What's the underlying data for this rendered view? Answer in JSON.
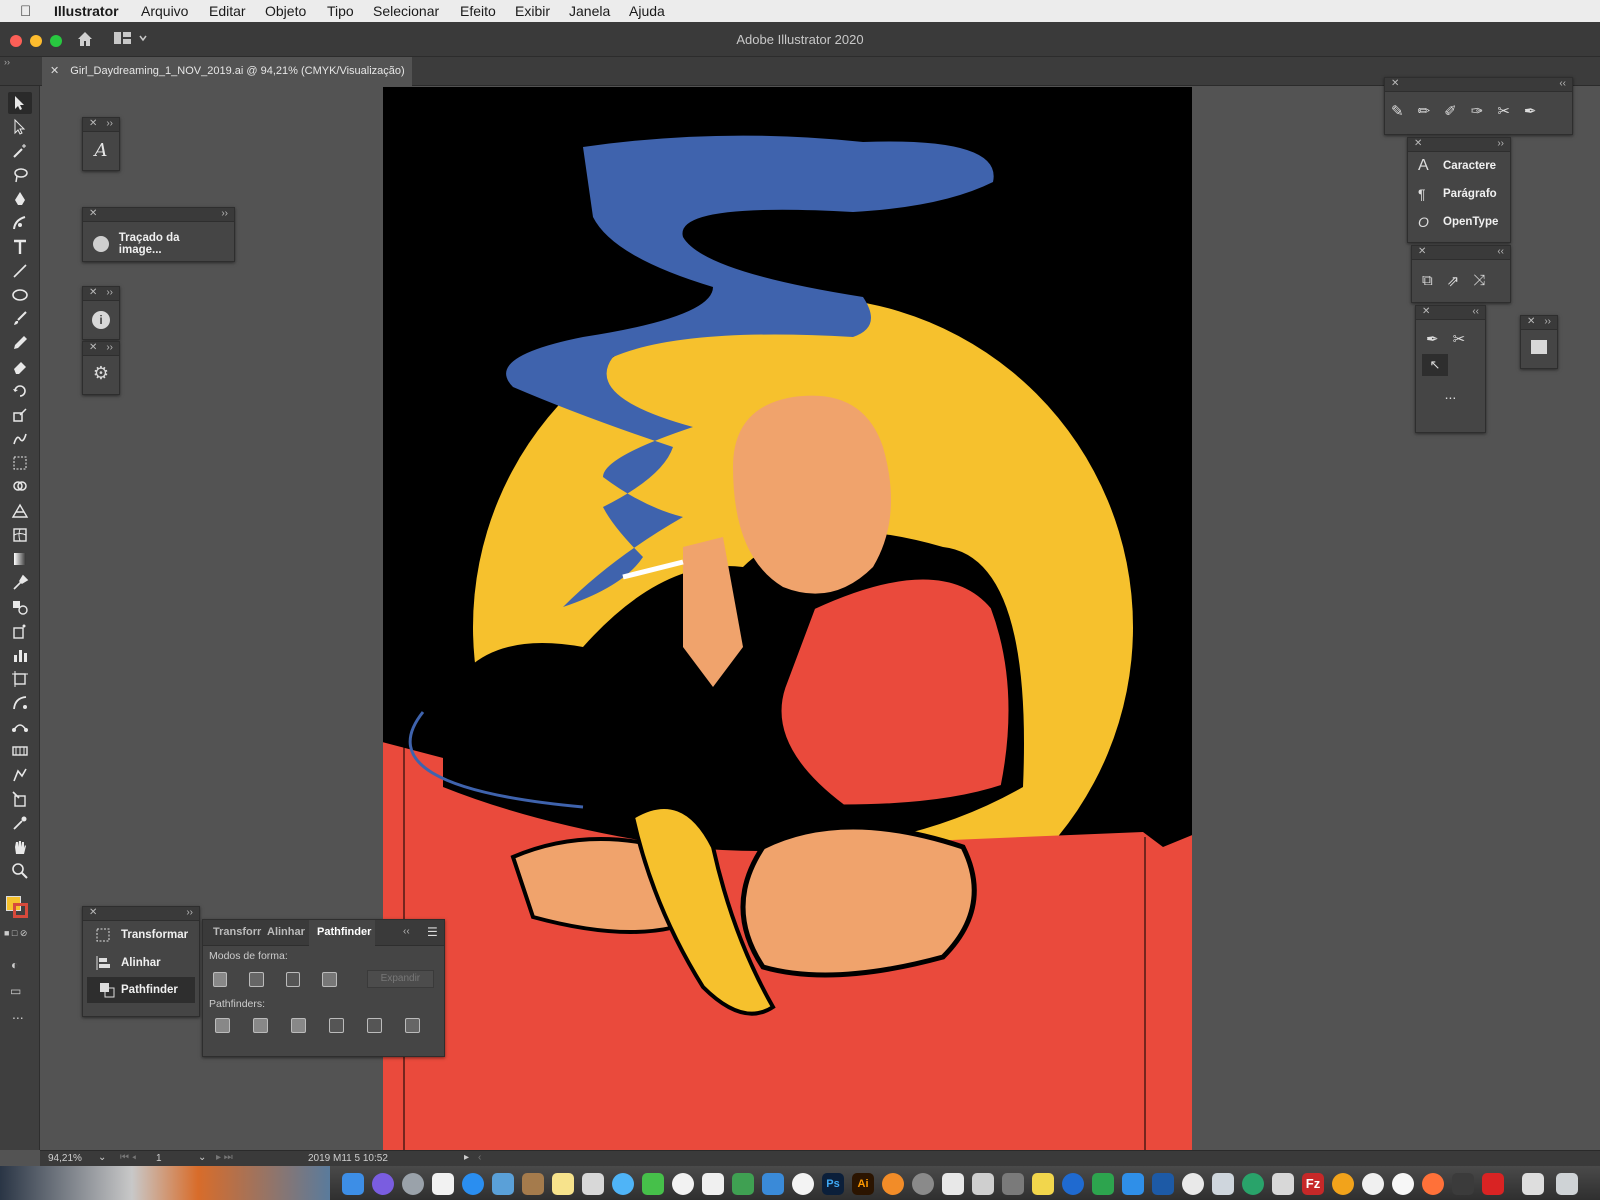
{
  "menubar": {
    "app_name": "Illustrator",
    "items": [
      "Arquivo",
      "Editar",
      "Objeto",
      "Tipo",
      "Selecionar",
      "Efeito",
      "Exibir",
      "Janela",
      "Ajuda"
    ]
  },
  "window": {
    "title": "Adobe Illustrator 2020"
  },
  "document_tab": {
    "label": "Girl_Daydreaming_1_NOV_2019.ai @ 94,21% (CMYK/Visualização)"
  },
  "toolbar": {
    "tools": [
      "selection-tool",
      "direct-selection-tool",
      "magic-wand-tool",
      "lasso-tool",
      "pen-tool",
      "curvature-tool",
      "type-tool",
      "line-tool",
      "ellipse-tool",
      "paintbrush-tool",
      "pencil-tool",
      "eraser-tool",
      "rotate-tool",
      "scale-tool",
      "warp-tool",
      "free-transform-tool",
      "shape-builder-tool",
      "perspective-grid-tool",
      "mesh-tool",
      "gradient-tool",
      "eyedropper-tool",
      "blend-tool",
      "symbol-sprayer-tool",
      "column-graph-tool",
      "artboard-tool",
      "slice-tool",
      "puppet-warp-tool",
      "width-tool",
      "chart-tool",
      "knife-tool",
      "crop-tool",
      "eyedropper-tool-2",
      "hand-tool",
      "zoom-tool"
    ]
  },
  "panels": {
    "image_trace": {
      "label": "Traçado da image..."
    },
    "character_group": {
      "items": [
        "Caractere",
        "Parágrafo",
        "OpenType"
      ]
    },
    "stack_panel": {
      "items": [
        "Transformar",
        "Alinhar",
        "Pathfinder"
      ]
    },
    "pathfinder": {
      "tabs": [
        "Transforr",
        "Alinhar",
        "Pathfinder"
      ],
      "shape_modes_label": "Modos de forma:",
      "expand_label": "Expandir",
      "pathfinders_label": "Pathfinders:"
    },
    "more_label": "..."
  },
  "statusbar": {
    "zoom": "94,21%",
    "page": "1",
    "info": "2019 M11 5  10:52"
  },
  "colors": {
    "fill": "#f6c12d",
    "stroke": "#d64a3c",
    "art_yellow": "#f6c12d",
    "art_blue": "#3f63ad",
    "art_red": "#ea4a3c",
    "art_skin": "#f0a36c"
  }
}
